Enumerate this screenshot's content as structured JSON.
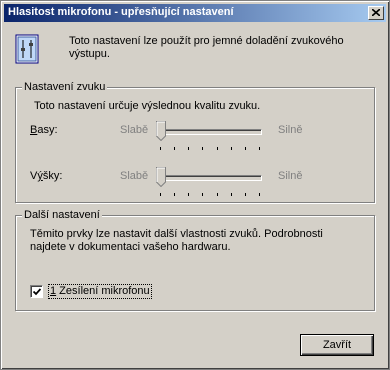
{
  "window": {
    "title": "Hlasitost mikrofonu - upřesňující nastavení",
    "close_icon": "close-icon"
  },
  "info": {
    "icon": "settings-info-icon",
    "text": "Toto nastavení lze použít pro jemné doladění zvukového výstupu."
  },
  "sound_settings": {
    "legend": "Nastavení zvuku",
    "description": "Toto nastavení určuje výslednou kvalitu zvuku.",
    "bass": {
      "label": "Basy:",
      "underline_char": "B",
      "label_rest": "asy:",
      "low_label": "Slabě",
      "high_label": "Silně",
      "level": 0,
      "enabled": false
    },
    "treble": {
      "label": "Výšky:",
      "label_pre": "V",
      "underline_char": "ý",
      "label_rest": "šky:",
      "low_label": "Slabě",
      "high_label": "Silně",
      "level": 0,
      "enabled": false
    }
  },
  "other_settings": {
    "legend": "Další nastavení",
    "description": "Těmito prvky lze nastavit další vlastnosti zvuků. Podrobnosti najdete v dokumentaci vašeho hardwaru.",
    "mic_boost": {
      "label": "1 Zesílení mikrofonu",
      "underline_char": "1",
      "label_rest": " Zesílení mikrofonu",
      "checked": true
    }
  },
  "buttons": {
    "close_label": "Zavřít"
  }
}
